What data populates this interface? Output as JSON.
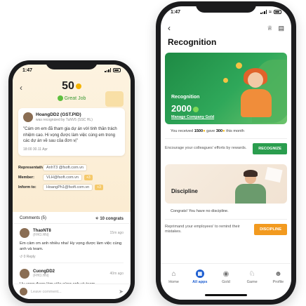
{
  "left_screen": {
    "status_time": "1:47",
    "amount": "50",
    "badge": "Great Job",
    "card": {
      "sender": "HoangDD2 (GST.PID)",
      "recognized_by": "was recognized by TuNV5 (SSC HL)",
      "message": "\"Cám ơn em đã tham gia dự án với tinh thần trách nhiệm cao. Hi vọng được làm việc cùng em trong các dự án về sau của đơn vị\"",
      "time": "18:00 30.11 Apr"
    },
    "fields": [
      {
        "label": "Representative:",
        "value": "AnhT3 @fsoft.com.vn"
      },
      {
        "label": "Member:",
        "value": "VLH@fsoft.com.vn",
        "extra": "+3"
      },
      {
        "label": "Inform to:",
        "value": "HoangPh1@fsoft.com.vn",
        "extra": "+3"
      }
    ],
    "comments_label": "Comments (5)",
    "congrats_label": "10 congrats",
    "comments": [
      {
        "name": "ThaoNT8",
        "sub": "(FHO.HN)",
        "ago": "15m ago",
        "text": "Em cảm ơn anh nhiều nha! Hy vọng được làm việc cùng anh và team.",
        "reply": "0 Reply"
      },
      {
        "name": "CuongDD2",
        "sub": "(FHO.HN)",
        "ago": "40m ago",
        "text": "Hy vọng được làm việc cùng anh và team.",
        "reply": ""
      }
    ],
    "leave_comment_placeholder": "Leave comment..."
  },
  "right_screen": {
    "status_time": "1:47",
    "title": "Recognition",
    "banner": {
      "label": "Recognition",
      "amount": "2000",
      "manage_link": "Manage Company Gold"
    },
    "summary_prefix": "You received",
    "summary_received": "1500",
    "summary_mid": "gave",
    "summary_gave": "300",
    "summary_suffix": "this month",
    "encourage_text": "Encourage your colleagues' efforts by rewards.",
    "recognize_button": "RECOGNIZE",
    "discipline": {
      "label": "Discipline",
      "congrats_text": "Congrats! You have no discipline.",
      "reprimand_text": "Reprimand your employees' to remind their mistakes.",
      "button": "DISCIPLINE"
    },
    "nav": [
      {
        "label": "Home",
        "icon": "home-icon"
      },
      {
        "label": "All apps",
        "icon": "apps-icon",
        "active": true
      },
      {
        "label": "Gold",
        "icon": "gold-icon"
      },
      {
        "label": "Game",
        "icon": "game-icon"
      },
      {
        "label": "Profile",
        "icon": "profile-icon"
      }
    ]
  },
  "colors": {
    "accent_green": "#2a9d4e",
    "accent_orange": "#f29a1f",
    "accent_blue": "#1f5fd1"
  }
}
